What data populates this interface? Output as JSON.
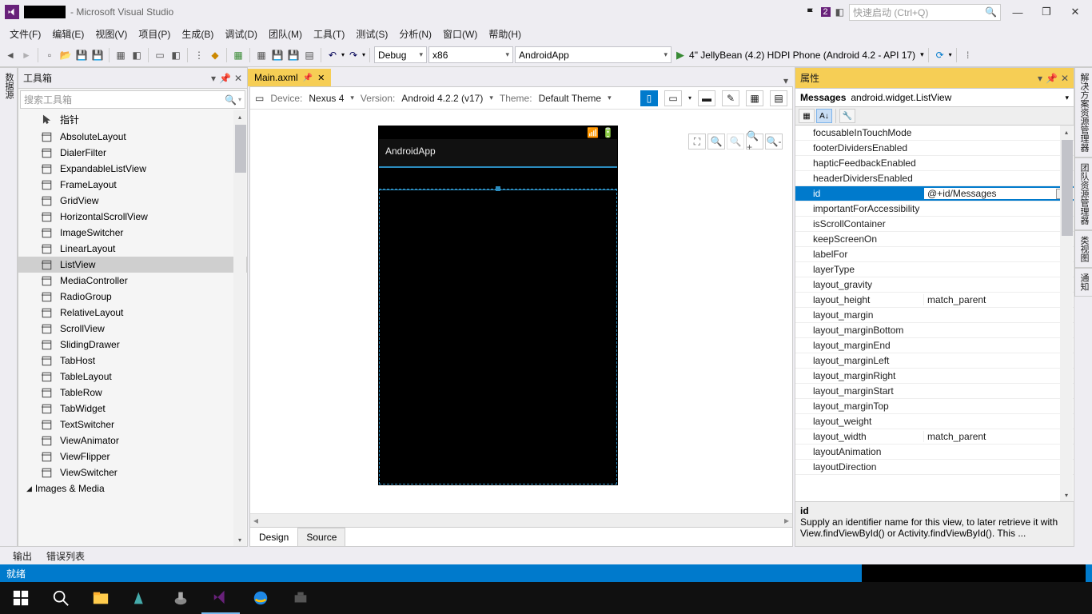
{
  "title": {
    "suffix": " - Microsoft Visual Studio"
  },
  "quicklaunch": {
    "placeholder": "快速启动 (Ctrl+Q)"
  },
  "notif": {
    "count": "2"
  },
  "menu": [
    "文件(F)",
    "编辑(E)",
    "视图(V)",
    "项目(P)",
    "生成(B)",
    "调试(D)",
    "团队(M)",
    "工具(T)",
    "测试(S)",
    "分析(N)",
    "窗口(W)",
    "帮助(H)"
  ],
  "toolbar": {
    "config": "Debug",
    "platform": "x86",
    "project": "AndroidApp",
    "target": "4\" JellyBean (4.2) HDPI Phone (Android 4.2 - API 17)"
  },
  "toolbox": {
    "title": "工具箱",
    "search": "搜索工具箱",
    "items": [
      {
        "label": "指针",
        "icon": "pointer"
      },
      {
        "label": "AbsoluteLayout",
        "icon": "layout"
      },
      {
        "label": "DialerFilter",
        "icon": "layout"
      },
      {
        "label": "ExpandableListView",
        "icon": "layout"
      },
      {
        "label": "FrameLayout",
        "icon": "layout"
      },
      {
        "label": "GridView",
        "icon": "layout"
      },
      {
        "label": "HorizontalScrollView",
        "icon": "layout"
      },
      {
        "label": "ImageSwitcher",
        "icon": "layout"
      },
      {
        "label": "LinearLayout",
        "icon": "layout"
      },
      {
        "label": "ListView",
        "icon": "layout",
        "selected": true
      },
      {
        "label": "MediaController",
        "icon": "layout"
      },
      {
        "label": "RadioGroup",
        "icon": "layout"
      },
      {
        "label": "RelativeLayout",
        "icon": "layout"
      },
      {
        "label": "ScrollView",
        "icon": "layout"
      },
      {
        "label": "SlidingDrawer",
        "icon": "layout"
      },
      {
        "label": "TabHost",
        "icon": "layout"
      },
      {
        "label": "TableLayout",
        "icon": "layout"
      },
      {
        "label": "TableRow",
        "icon": "layout"
      },
      {
        "label": "TabWidget",
        "icon": "layout"
      },
      {
        "label": "TextSwitcher",
        "icon": "layout"
      },
      {
        "label": "ViewAnimator",
        "icon": "layout"
      },
      {
        "label": "ViewFlipper",
        "icon": "layout"
      },
      {
        "label": "ViewSwitcher",
        "icon": "layout"
      }
    ],
    "group2": "Images & Media"
  },
  "sidetab_left": "数据源",
  "sidetabs_right": [
    "解决方案资源管理器",
    "团队资源管理器",
    "类视图",
    "通知"
  ],
  "doc": {
    "tab": "Main.axml"
  },
  "designer": {
    "device_lbl": "Device:",
    "device": "Nexus 4",
    "version_lbl": "Version:",
    "version": "Android 4.2.2 (v17)",
    "theme_lbl": "Theme:",
    "theme": "Default Theme",
    "app_title": "AndroidApp",
    "tabs": {
      "design": "Design",
      "source": "Source"
    }
  },
  "props": {
    "title": "属性",
    "obj_name": "Messages",
    "obj_type": "android.widget.ListView",
    "rows": [
      {
        "k": "focusableInTouchMode",
        "v": ""
      },
      {
        "k": "footerDividersEnabled",
        "v": ""
      },
      {
        "k": "hapticFeedbackEnabled",
        "v": ""
      },
      {
        "k": "headerDividersEnabled",
        "v": ""
      },
      {
        "k": "id",
        "v": "@+id/Messages",
        "selected": true
      },
      {
        "k": "importantForAccessibility",
        "v": ""
      },
      {
        "k": "isScrollContainer",
        "v": ""
      },
      {
        "k": "keepScreenOn",
        "v": ""
      },
      {
        "k": "labelFor",
        "v": ""
      },
      {
        "k": "layerType",
        "v": ""
      },
      {
        "k": "layout_gravity",
        "v": ""
      },
      {
        "k": "layout_height",
        "v": "match_parent"
      },
      {
        "k": "layout_margin",
        "v": ""
      },
      {
        "k": "layout_marginBottom",
        "v": ""
      },
      {
        "k": "layout_marginEnd",
        "v": ""
      },
      {
        "k": "layout_marginLeft",
        "v": ""
      },
      {
        "k": "layout_marginRight",
        "v": ""
      },
      {
        "k": "layout_marginStart",
        "v": ""
      },
      {
        "k": "layout_marginTop",
        "v": ""
      },
      {
        "k": "layout_weight",
        "v": ""
      },
      {
        "k": "layout_width",
        "v": "match_parent"
      },
      {
        "k": "layoutAnimation",
        "v": ""
      },
      {
        "k": "layoutDirection",
        "v": ""
      }
    ],
    "desc_title": "id",
    "desc": "Supply an identifier name for this view, to later retrieve it with View.findViewById() or Activity.findViewById(). This ..."
  },
  "output_tabs": [
    "输出",
    "错误列表"
  ],
  "status": "就绪"
}
